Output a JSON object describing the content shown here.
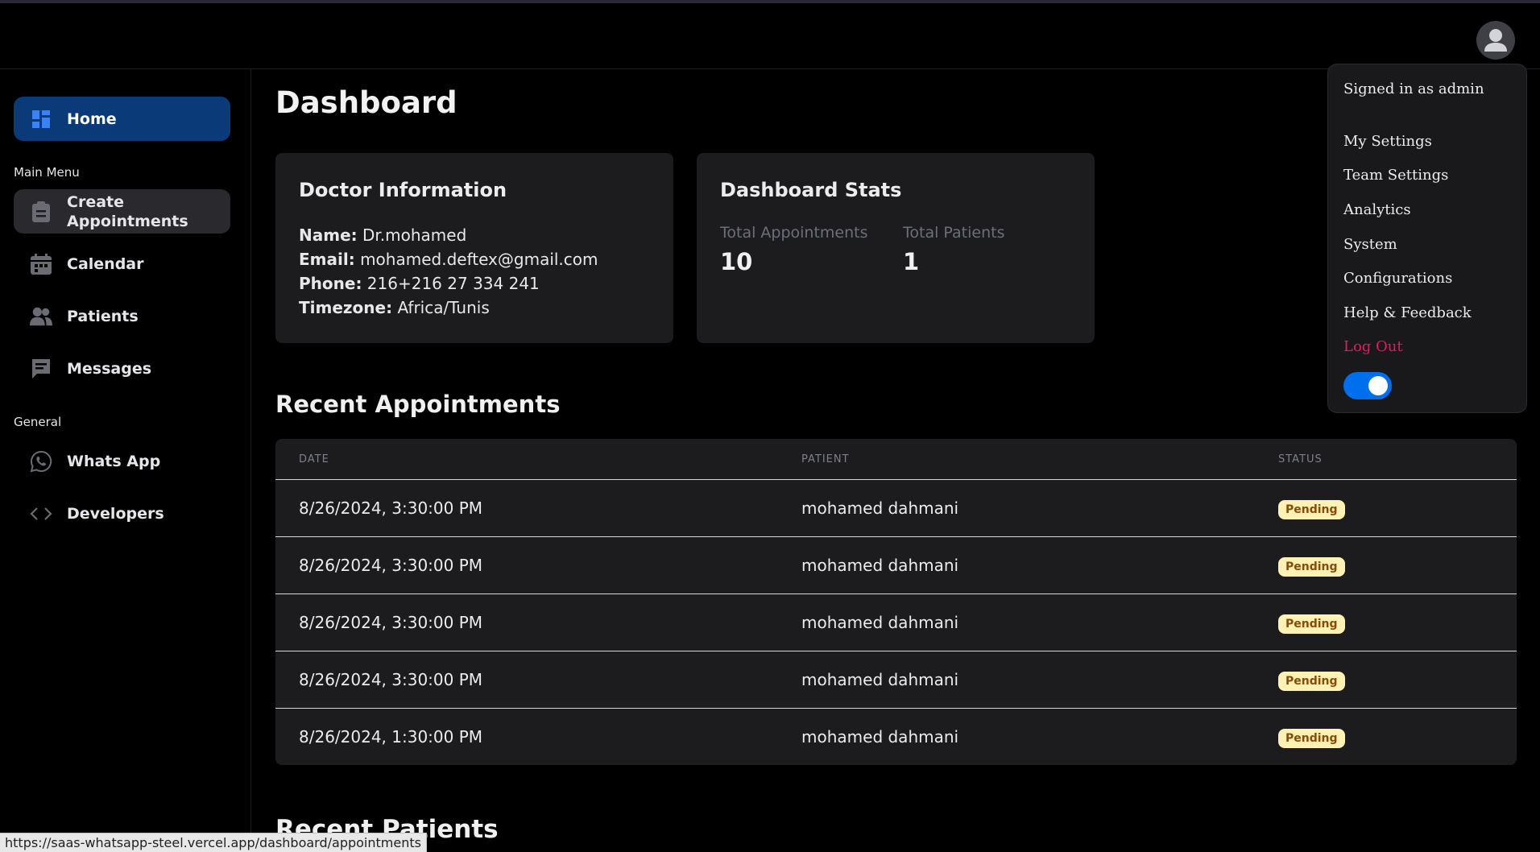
{
  "sidebar": {
    "items": [
      {
        "label": "Home",
        "icon": "dashboard-grid-icon"
      },
      {
        "label": "Create Appointments",
        "icon": "clipboard-icon"
      },
      {
        "label": "Calendar",
        "icon": "calendar-icon"
      },
      {
        "label": "Patients",
        "icon": "users-icon"
      },
      {
        "label": "Messages",
        "icon": "message-icon"
      },
      {
        "label": "Whats App",
        "icon": "whatsapp-icon"
      },
      {
        "label": "Developers",
        "icon": "code-icon"
      }
    ],
    "main_menu_label": "Main Menu",
    "general_label": "General"
  },
  "page": {
    "title": "Dashboard"
  },
  "doctor": {
    "title": "Doctor Information",
    "name_label": "Name:",
    "name": "Dr.mohamed",
    "email_label": "Email:",
    "email": "mohamed.deftex@gmail.com",
    "phone_label": "Phone:",
    "phone": "216+216 27 334 241",
    "timezone_label": "Timezone:",
    "timezone": "Africa/Tunis"
  },
  "stats": {
    "title": "Dashboard Stats",
    "total_appointments_label": "Total Appointments",
    "total_appointments": "10",
    "total_patients_label": "Total Patients",
    "total_patients": "1"
  },
  "appointments": {
    "title": "Recent Appointments",
    "headers": {
      "date": "DATE",
      "patient": "PATIENT",
      "status": "STATUS"
    },
    "rows": [
      {
        "date": "8/26/2024, 3:30:00 PM",
        "patient": "mohamed dahmani",
        "status": "Pending"
      },
      {
        "date": "8/26/2024, 3:30:00 PM",
        "patient": "mohamed dahmani",
        "status": "Pending"
      },
      {
        "date": "8/26/2024, 3:30:00 PM",
        "patient": "mohamed dahmani",
        "status": "Pending"
      },
      {
        "date": "8/26/2024, 3:30:00 PM",
        "patient": "mohamed dahmani",
        "status": "Pending"
      },
      {
        "date": "8/26/2024, 1:30:00 PM",
        "patient": "mohamed dahmani",
        "status": "Pending"
      }
    ]
  },
  "recent_patients": {
    "title": "Recent Patients"
  },
  "user_menu": {
    "signed_in": "Signed in as admin",
    "items": [
      "My Settings",
      "Team Settings",
      "Analytics",
      "System",
      "Configurations",
      "Help & Feedback"
    ],
    "logout": "Log Out",
    "theme_toggle_on": true
  },
  "status_url": "https://saas-whatsapp-steel.vercel.app/dashboard/appointments",
  "colors": {
    "accent": "#006fee",
    "active_nav": "#0a3a78",
    "danger": "#f31260",
    "pending_bg": "#fdf1b3",
    "pending_text": "#8a4b07"
  }
}
